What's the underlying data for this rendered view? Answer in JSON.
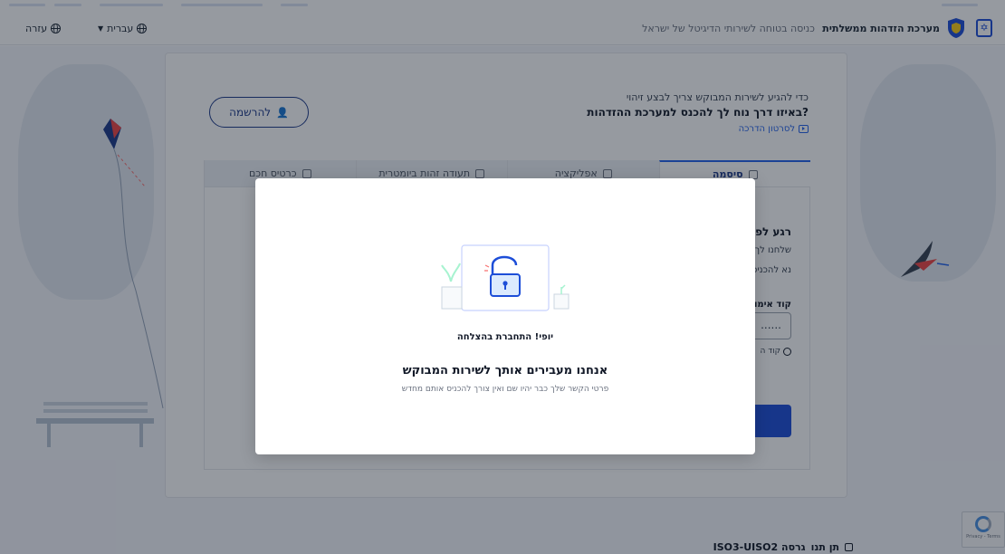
{
  "header": {
    "title": "מערכת הזדהות ממשלתית",
    "subtitle": "כניסה בטוחה לשירותי הדיגיטל של ישראל",
    "language": "עברית",
    "help": "עזרה"
  },
  "card": {
    "question_line1": "כדי להגיע לשירות המבוקש צריך לבצע זיהוי",
    "question_line2": "באיזו דרך נוח לך להכנס למערכת ההזדהות?",
    "video_link": "לסרטון הדרכה",
    "register_button": "להרשמה",
    "tabs": [
      {
        "label": "סיסמה",
        "active": true
      },
      {
        "label": "אפליקציה",
        "active": false
      },
      {
        "label": "תעודה זהות ביומטרית",
        "active": false
      },
      {
        "label": "כרטיס חכם",
        "active": false
      }
    ],
    "panel": {
      "title": "רגע לפני",
      "line1": "שלחנו לך",
      "line2": "נא להכניס",
      "code_label": "קוד אימות",
      "code_value": "......",
      "hint": "קוד ה"
    }
  },
  "modal": {
    "success": "יופי! התחברת בהצלחה",
    "title": "אנחנו מעבירים אותך לשירות המבוקש",
    "subtitle": "פרטי הקשר שלך כבר יהיו שם ואין צורך להכניס אותם מחדש"
  },
  "footer": {
    "version": "ISO3-UISO2 גרסה",
    "label": "תן תנו"
  },
  "recaptcha": {
    "text": "Privacy - Terms"
  },
  "colors": {
    "primary": "#1d4ed8",
    "navy": "#1e3a8a",
    "overlay": "rgba(17,24,39,0.44)"
  }
}
